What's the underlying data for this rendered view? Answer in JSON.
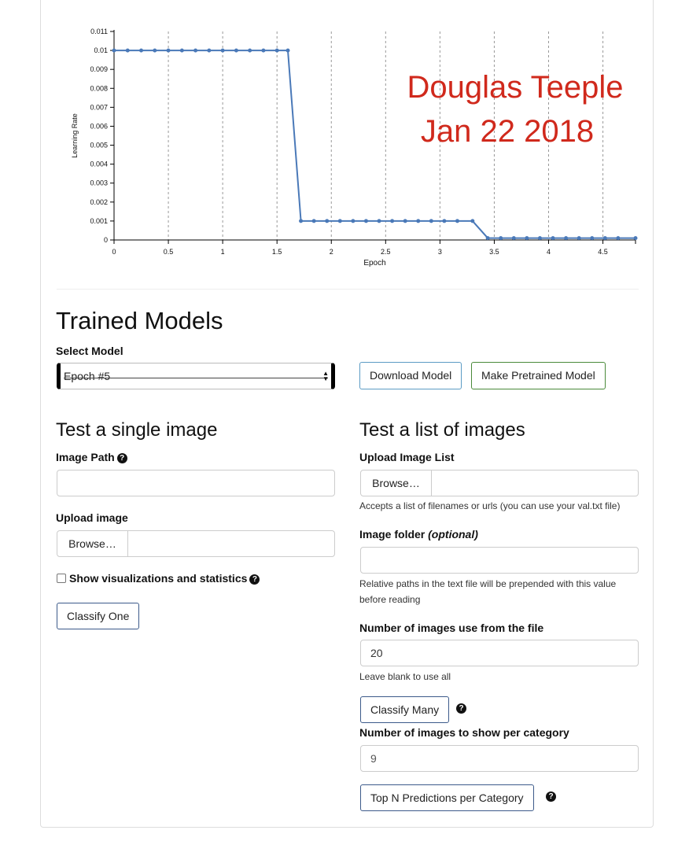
{
  "chart_data": {
    "type": "line",
    "title": "",
    "xlabel": "Epoch",
    "ylabel": "Learning Rate",
    "xlim": [
      0,
      4.8
    ],
    "ylim": [
      0,
      0.011
    ],
    "x_ticks": [
      "0",
      "0.5",
      "1",
      "1.5",
      "2",
      "2.5",
      "3",
      "3.5",
      "4",
      "4.5"
    ],
    "y_ticks": [
      "0",
      "0.001",
      "0.002",
      "0.003",
      "0.004",
      "0.005",
      "0.006",
      "0.007",
      "0.008",
      "0.009",
      "0.01",
      "0.011"
    ],
    "grid_x": true,
    "line_color": "#4a79b8",
    "series": [
      {
        "x": [
          0,
          0.125,
          0.25,
          0.375,
          0.5,
          0.625,
          0.75,
          0.875,
          1.0,
          1.125,
          1.25,
          1.375,
          1.5,
          1.6,
          1.72,
          1.84,
          1.96,
          2.08,
          2.2,
          2.32,
          2.44,
          2.56,
          2.68,
          2.8,
          2.92,
          3.04,
          3.16,
          3.3,
          3.44,
          3.56,
          3.68,
          3.8,
          3.92,
          4.04,
          4.16,
          4.28,
          4.4,
          4.52,
          4.64,
          4.8
        ],
        "y": [
          0.01,
          0.01,
          0.01,
          0.01,
          0.01,
          0.01,
          0.01,
          0.01,
          0.01,
          0.01,
          0.01,
          0.01,
          0.01,
          0.01,
          0.001,
          0.001,
          0.001,
          0.001,
          0.001,
          0.001,
          0.001,
          0.001,
          0.001,
          0.001,
          0.001,
          0.001,
          0.001,
          0.001,
          0.0001,
          0.0001,
          0.0001,
          0.0001,
          0.0001,
          0.0001,
          0.0001,
          0.0001,
          0.0001,
          0.0001,
          0.0001,
          0.0001
        ]
      }
    ],
    "annotation": {
      "lines": [
        "Douglas Teeple",
        "Jan 22 2018"
      ],
      "color": "#d0291c"
    }
  },
  "trained_models": {
    "heading": "Trained Models",
    "select_label": "Select Model",
    "selected": "Epoch #5",
    "download_label": "Download Model",
    "pretrained_label": "Make Pretrained Model"
  },
  "single": {
    "heading": "Test a single image",
    "path_label": "Image Path",
    "path_value": "",
    "upload_label": "Upload image",
    "browse_label": "Browse…",
    "viz_label": "Show visualizations and statistics",
    "classify_label": "Classify One"
  },
  "list": {
    "heading": "Test a list of images",
    "upload_label": "Upload Image List",
    "browse_label": "Browse…",
    "upload_help": "Accepts a list of filenames or urls (you can use your val.txt file)",
    "folder_label": "Image folder ",
    "folder_optional": "(optional)",
    "folder_value": "",
    "folder_help_1": "Relative paths in the text file will be prepended with this value",
    "folder_help_2": "before reading",
    "num_label": "Number of images use from the file",
    "num_value": "20",
    "num_help": "Leave blank to use all",
    "classify_many_label": "Classify Many",
    "per_cat_label": "Number of images to show per category",
    "per_cat_value": "9",
    "topn_label": "Top N Predictions per Category"
  },
  "icons": {
    "help": "question-circle-icon",
    "select_arrows": "updown-arrows-icon"
  },
  "colors": {
    "accent_blue": "#4a79b8",
    "success": "#4a8a3a",
    "info": "#5b9bc4"
  }
}
